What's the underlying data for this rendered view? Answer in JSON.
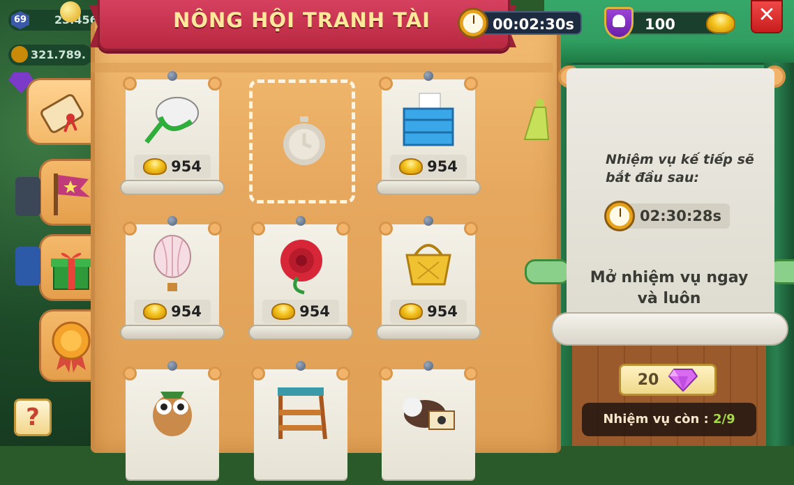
{
  "title": "NÔNG HỘI TRANH TÀI",
  "header": {
    "event_timer": "00:02:30s",
    "trophy_points": "100",
    "close_label": "✕"
  },
  "hud": {
    "level": "69",
    "coins_partial": "23.456",
    "gold_partial": "321.789."
  },
  "tasks": [
    {
      "item": "butterfly-net",
      "price": "954"
    },
    {
      "item": "empty-slot-timer",
      "price": ""
    },
    {
      "item": "blue-crate",
      "price": "954"
    },
    {
      "item": "hot-air-balloon",
      "price": "954"
    },
    {
      "item": "red-rose",
      "price": "954"
    },
    {
      "item": "picnic-basket",
      "price": "954"
    },
    {
      "item": "owl",
      "price": ""
    },
    {
      "item": "wooden-shelf",
      "price": ""
    },
    {
      "item": "cow-camera",
      "price": ""
    }
  ],
  "info": {
    "next_task_text_1": "Nhiệm vụ kế tiếp sẽ",
    "next_task_text_2": "bắt đầu sau:",
    "next_task_timer": "02:30:28s",
    "unlock_text_1": "Mở nhiệm vụ ngay",
    "unlock_text_2": "và luôn",
    "gem_cost": "20",
    "remaining_label": "Nhiệm vụ còn : ",
    "remaining_value": "2/9"
  },
  "help_label": "?",
  "colors": {
    "ribbon": "#c8334f",
    "title_text": "#ffe89a",
    "board": "#e8ac60",
    "curtain": "#2b8a55",
    "close": "#e02f2f",
    "remaining_highlight": "#a7e44b"
  }
}
